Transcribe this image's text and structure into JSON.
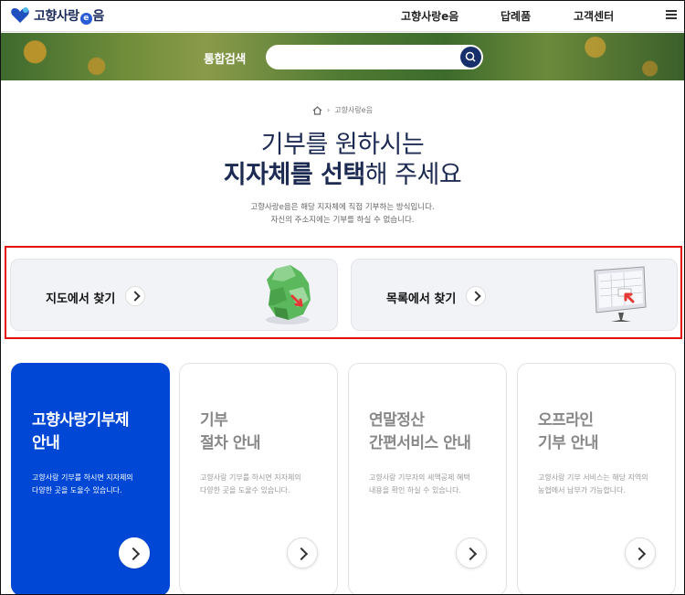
{
  "header": {
    "logo_text": "고향사랑",
    "logo_e": "e",
    "logo_suffix": "음",
    "nav": [
      "고향사랑e음",
      "답례품",
      "고객센터"
    ]
  },
  "search": {
    "label": "통합검색",
    "placeholder": ""
  },
  "breadcrumb": {
    "current": "고향사랑e음"
  },
  "intro": {
    "title_line1": "기부를 원하시는",
    "title_bold1": "지자체",
    "title_mid": "를 ",
    "title_bold2": "선택",
    "title_end": "해 주세요",
    "desc_line1": "고향사랑e음은 해당 지자체에 직접 기부하는 방식입니다.",
    "desc_line2": "자신의 주소지에는 기부를 하실 수 없습니다."
  },
  "finders": [
    {
      "label": "지도에서 찾기"
    },
    {
      "label": "목록에서 찾기"
    }
  ],
  "cards": [
    {
      "title": "고향사랑기부제\n안내",
      "text": "고향사랑 기부를 하시면 지자체의\n다양한 곳을 도울수 있습니다."
    },
    {
      "title": "기부\n절차 안내",
      "text": "고향사랑 기부를 하시면 지자체의\n다양한 곳을 도울수 있습니다."
    },
    {
      "title": "연말정산\n간편서비스 안내",
      "text": "고향사랑 기부자의 세액공제 혜택\n내용을 확인 하실 수 있습니다."
    },
    {
      "title": "오프라인\n기부 안내",
      "text": "고향사랑 기부 서비스는 해당 지역의\n농협에서 납부가 가능합니다."
    }
  ],
  "colors": {
    "primary": "#0047d6",
    "navy": "#1d2b52",
    "highlight": "#e01010"
  }
}
